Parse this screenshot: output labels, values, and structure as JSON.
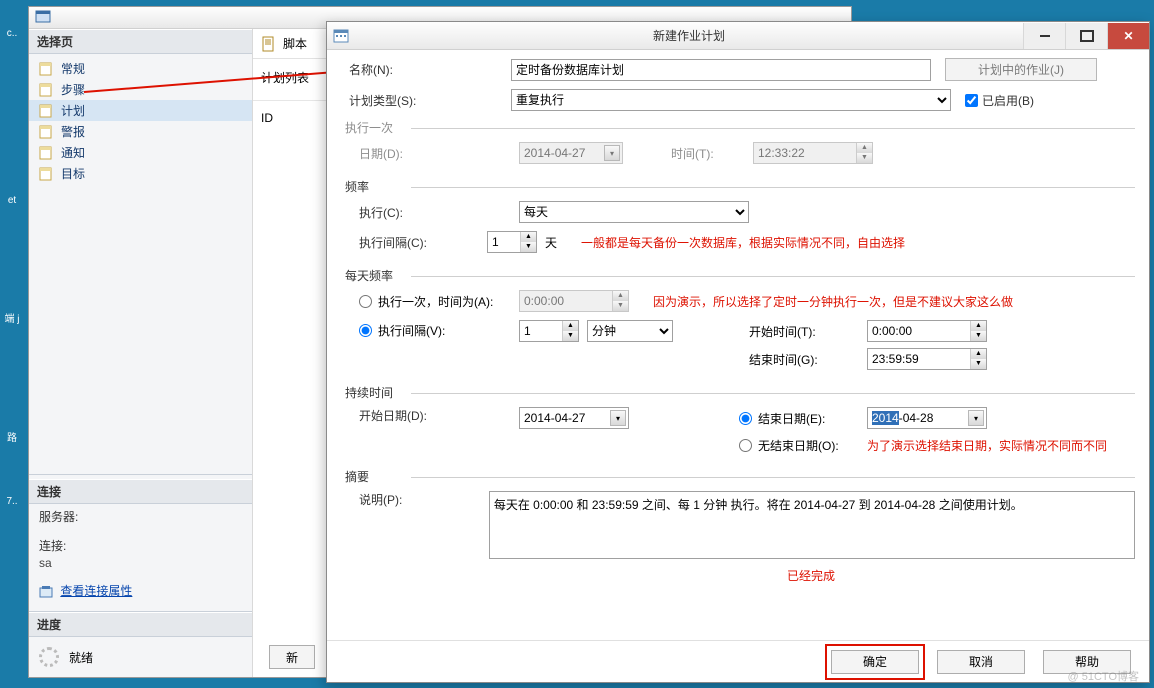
{
  "desktop": {
    "icons": [
      "c..",
      "",
      "",
      "et",
      "",
      "端  j",
      "",
      "路",
      "7..",
      ""
    ]
  },
  "bgwin": {
    "leftpane": {
      "select_header": "选择页",
      "items": [
        "常规",
        "步骤",
        "计划",
        "警报",
        "通知",
        "目标"
      ],
      "conn_header": "连接",
      "server_label": "服务器:",
      "server_value": "",
      "conn_label": "连接:",
      "conn_value": "sa",
      "view_conn_props": "查看连接属性",
      "progress_header": "进度",
      "progress_status": "就绪"
    },
    "rightpane": {
      "script_btn": "脚本",
      "list_label": "计划列表",
      "col_id": "ID",
      "new_btn": "新"
    }
  },
  "dialog": {
    "title": "新建作业计划",
    "name_label": "名称(N):",
    "name_value": "定时备份数据库计划",
    "jobs_in_plan_btn": "计划中的作业(J)",
    "type_label": "计划类型(S):",
    "type_value": "重复执行",
    "enabled_label": "已启用(B)",
    "once_header": "执行一次",
    "date_label": "日期(D):",
    "date_value": "2014-04-27",
    "time_label": "时间(T):",
    "time_value": "12:33:22",
    "freq_header": "频率",
    "exec_label": "执行(C):",
    "exec_value": "每天",
    "interval_label": "执行间隔(C):",
    "interval_value": "1",
    "interval_unit": "天",
    "interval_note": "一般都是每天备份一次数据库，根据实际情况不同，自由选择",
    "daily_header": "每天频率",
    "once_at_label": "执行一次，时间为(A):",
    "once_at_value": "0:00:00",
    "once_at_note": "因为演示，所以选择了定时一分钟执行一次，但是不建议大家这么做",
    "repeat_label": "执行间隔(V):",
    "repeat_value": "1",
    "repeat_unit": "分钟",
    "start_time_label": "开始时间(T):",
    "start_time_value": "0:00:00",
    "end_time_label": "结束时间(G):",
    "end_time_value": "23:59:59",
    "duration_header": "持续时间",
    "start_date_label": "开始日期(D):",
    "start_date_value": "2014-04-27",
    "end_date_label": "结束日期(E):",
    "end_date_value_prefix": "2014",
    "end_date_value_suffix": "-04-28",
    "no_end_label": "无结束日期(O):",
    "no_end_note": "为了演示选择结束日期，实际情况不同而不同",
    "summary_header": "摘要",
    "desc_label": "说明(P):",
    "desc_value": "每天在 0:00:00 和 23:59:59 之间、每 1 分钟 执行。将在 2014-04-27 到 2014-04-28 之间使用计划。",
    "done_note": "已经完成",
    "ok_btn": "确定",
    "cancel_btn": "取消",
    "help_btn": "帮助"
  },
  "watermark": "@ 51CTO博客"
}
